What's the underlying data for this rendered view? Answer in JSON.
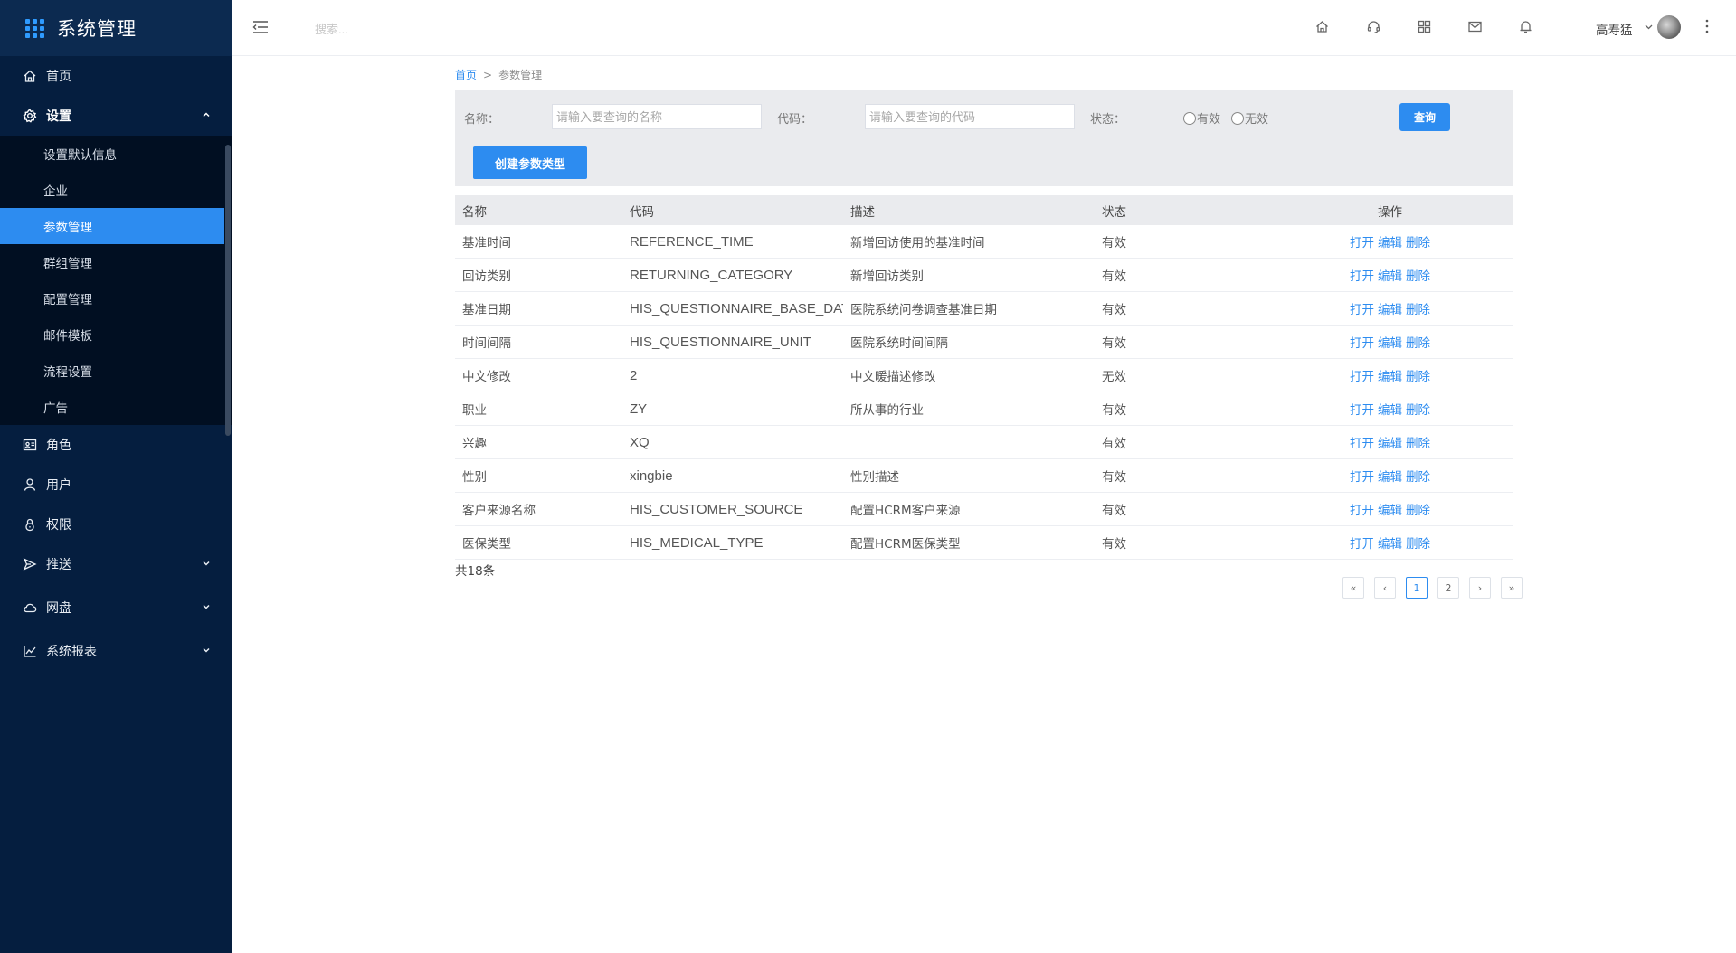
{
  "app": {
    "title": "系统管理"
  },
  "sidebar": {
    "items": [
      {
        "label": "首页",
        "icon": "home-icon"
      },
      {
        "label": "设置",
        "icon": "gear-icon"
      },
      {
        "label": "角色",
        "icon": "id-card-icon"
      },
      {
        "label": "用户",
        "icon": "user-icon"
      },
      {
        "label": "权限",
        "icon": "lock-icon"
      },
      {
        "label": "推送",
        "icon": "send-icon"
      },
      {
        "label": "网盘",
        "icon": "cloud-icon"
      },
      {
        "label": "系统报表",
        "icon": "line-chart-icon"
      }
    ],
    "settings_sub": [
      "设置默认信息",
      "企业",
      "参数管理",
      "群组管理",
      "配置管理",
      "邮件模板",
      "流程设置",
      "广告"
    ],
    "active_sub": "参数管理"
  },
  "topbar": {
    "search_placeholder": "搜索...",
    "user_name": "高寿猛",
    "icons": [
      "home-icon",
      "headset-icon",
      "grid-icon",
      "mail-icon",
      "bell-icon",
      "more-vertical-icon"
    ]
  },
  "breadcrumb": {
    "home": "首页",
    "separator": ">",
    "current": "参数管理"
  },
  "filter": {
    "name_label": "名称：",
    "name_placeholder": "请输入要查询的名称",
    "code_label": "代码：",
    "code_placeholder": "请输入要查询的代码",
    "status_label": "状态：",
    "status_options": [
      "有效",
      "无效"
    ],
    "query_button": "查询",
    "create_button": "创建参数类型"
  },
  "table": {
    "headers": [
      "名称",
      "代码",
      "描述",
      "状态",
      "操作"
    ],
    "actions": [
      "打开",
      "编辑",
      "删除"
    ],
    "rows": [
      [
        "基准时间",
        "REFERENCE_TIME",
        "新增回访使用的基准时间",
        "有效"
      ],
      [
        "回访类别",
        "RETURNING_CATEGORY",
        "新增回访类别",
        "有效"
      ],
      [
        "基准日期",
        "HIS_QUESTIONNAIRE_BASE_DATE",
        "医院系统问卷调查基准日期",
        "有效"
      ],
      [
        "时间间隔",
        "HIS_QUESTIONNAIRE_UNIT",
        "医院系统时间间隔",
        "有效"
      ],
      [
        "中文修改",
        "2",
        "中文暖描述修改",
        "无效"
      ],
      [
        "职业",
        "ZY",
        "所从事的行业",
        "有效"
      ],
      [
        "兴趣",
        "XQ",
        "",
        "有效"
      ],
      [
        "性别",
        "xingbie",
        "性别描述",
        "有效"
      ],
      [
        "客户来源名称",
        "HIS_CUSTOMER_SOURCE",
        "配置HCRM客户来源",
        "有效"
      ],
      [
        "医保类型",
        "HIS_MEDICAL_TYPE",
        "配置HCRM医保类型",
        "有效"
      ]
    ]
  },
  "pagination": {
    "total_text": "共18条",
    "buttons": [
      "«",
      "‹",
      "1",
      "2",
      "›",
      "»"
    ],
    "current": "1"
  },
  "colors": {
    "accent": "#2d8cf0",
    "sidebar_bg": "#051e3f",
    "sidebar_header_bg": "#0c2a50"
  }
}
